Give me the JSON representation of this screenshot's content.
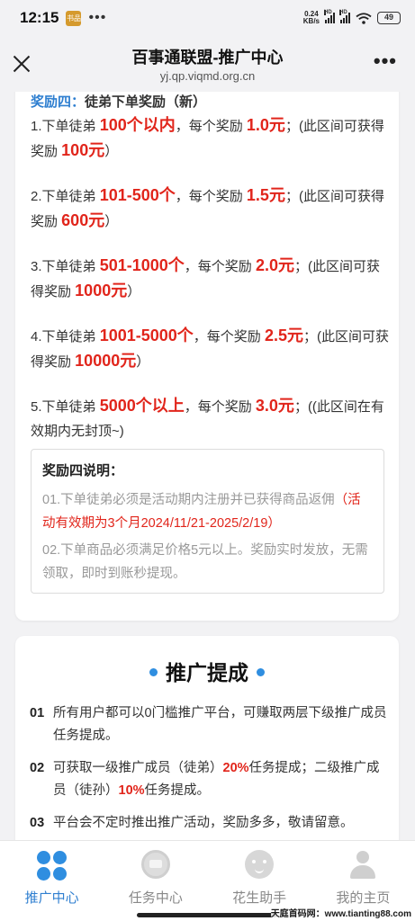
{
  "status": {
    "time": "12:15",
    "app_badge": "书品",
    "more_dots": "•••",
    "net_speed_value": "0.24",
    "net_speed_unit": "KB/s",
    "signal_tag": "HD",
    "battery": "49"
  },
  "header": {
    "title": "百事通联盟-推广中心",
    "url": "yj.qp.viqmd.org.cn",
    "more_label": "•••"
  },
  "reward": {
    "heading_blue": "奖励四：",
    "heading_rest": "徒弟下单奖励（新）",
    "items": [
      {
        "a": "1.下单徒弟 ",
        "range": "100个以内",
        "b": "，每个奖励 ",
        "price": "1.0元",
        "c": "；(此区间可获得奖励 ",
        "total": "100元",
        "d": "）"
      },
      {
        "a": "2.下单徒弟 ",
        "range": "101-500个",
        "b": "，每个奖励 ",
        "price": "1.5元",
        "c": "；(此区间可获得奖励 ",
        "total": "600元",
        "d": "）"
      },
      {
        "a": "3.下单徒弟 ",
        "range": "501-1000个",
        "b": "，每个奖励 ",
        "price": "2.0元",
        "c": "；(此区间可获得奖励 ",
        "total": "1000元",
        "d": "）"
      },
      {
        "a": "4.下单徒弟 ",
        "range": "1001-5000个",
        "b": "，每个奖励 ",
        "price": "2.5元",
        "c": "；(此区间可获得奖励 ",
        "total": "10000元",
        "d": "）"
      },
      {
        "a": "5.下单徒弟 ",
        "range": "5000个以上",
        "b": "，每个奖励 ",
        "price": "3.0元",
        "c": "；((此区间在有效期内无封顶~)",
        "total": "",
        "d": ""
      }
    ],
    "notes_title": "奖励四说明：",
    "note1_a": "01.下单徒弟必须是活动期内注册并已获得商品返佣",
    "note1_red": "（活动有效期为3个月2024/11/21-2025/2/19）",
    "note2": "02.下单商品必须满足价格5元以上。奖励实时发放，无需领取，即时到账秒提现。"
  },
  "promo": {
    "title": "推广提成",
    "rules": [
      {
        "num": "01",
        "a": "所有用户都可以0门槛推广平台，可赚取两层下级推广成员任务提成。",
        "r1": "",
        "b": "",
        "r2": "",
        "c": ""
      },
      {
        "num": "02",
        "a": "可获取一级推广成员（徒弟）",
        "r1": "20%",
        "b": "任务提成；二级推广成员（徒孙）",
        "r2": "10%",
        "c": "任务提成。"
      },
      {
        "num": "03",
        "a": "平台会不定时推出推广活动，奖励多多，敬请留意。",
        "r1": "",
        "b": "",
        "r2": "",
        "c": ""
      }
    ]
  },
  "tabs": [
    {
      "label": "推广中心",
      "icon": "grid-icon",
      "active": true
    },
    {
      "label": "任务中心",
      "icon": "task-icon",
      "active": false
    },
    {
      "label": "花生助手",
      "icon": "helper-icon",
      "active": false
    },
    {
      "label": "我的主页",
      "icon": "user-icon",
      "active": false
    }
  ],
  "watermark": "天庭首码网：www.tianting88.com",
  "colors": {
    "accent_blue": "#2f7fd0",
    "highlight_red": "#e1251b",
    "background": "#f2f2f4"
  }
}
